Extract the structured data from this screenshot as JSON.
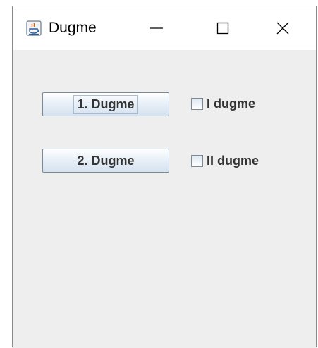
{
  "window": {
    "title": "Dugme",
    "controls": {
      "minimize": "minimize-icon",
      "maximize": "maximize-icon",
      "close": "close-icon"
    }
  },
  "buttons": [
    {
      "label": "1. Dugme"
    },
    {
      "label": "2. Dugme"
    }
  ],
  "checkboxes": [
    {
      "label": "I dugme",
      "checked": false
    },
    {
      "label": "II dugme",
      "checked": false
    }
  ],
  "colors": {
    "content_background": "#eeeeee",
    "titlebar_background": "#ffffff",
    "text": "#333333"
  }
}
